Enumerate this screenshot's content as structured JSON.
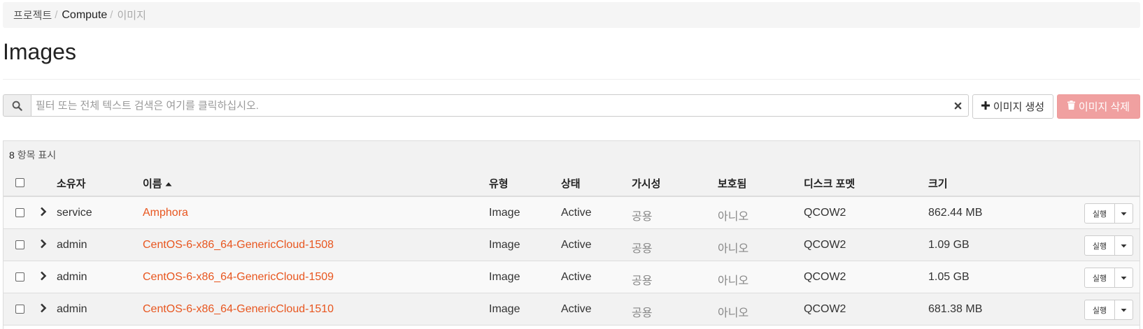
{
  "breadcrumb": {
    "items": [
      "프로젝트",
      "Compute",
      "이미지"
    ]
  },
  "page": {
    "title": "Images"
  },
  "search": {
    "placeholder": "필터 또는 전체 텍스트 검색은 여기를 클릭하십시오.",
    "icon": "search-icon",
    "clear_icon": "close-icon"
  },
  "actions": {
    "create_label": "이미지 생성",
    "delete_label": "이미지 삭제",
    "create_icon": "plus-icon",
    "delete_icon": "trash-icon"
  },
  "table": {
    "count_number": "8",
    "count_text": "항목 표시",
    "headers": {
      "owner": "소유자",
      "name": "이름",
      "type": "유형",
      "status": "상태",
      "visibility": "가시성",
      "protected": "보호됨",
      "disk_format": "디스크 포멧",
      "size": "크기"
    },
    "sort": {
      "column": "name",
      "direction": "asc"
    },
    "rows": [
      {
        "owner": "service",
        "name": "Amphora",
        "type": "Image",
        "status": "Active",
        "visibility": "공용",
        "protected": "아니오",
        "disk_format": "QCOW2",
        "size": "862.44 MB",
        "action": "실행"
      },
      {
        "owner": "admin",
        "name": "CentOS-6-x86_64-GenericCloud-1508",
        "type": "Image",
        "status": "Active",
        "visibility": "공용",
        "protected": "아니오",
        "disk_format": "QCOW2",
        "size": "1.09 GB",
        "action": "실행"
      },
      {
        "owner": "admin",
        "name": "CentOS-6-x86_64-GenericCloud-1509",
        "type": "Image",
        "status": "Active",
        "visibility": "공용",
        "protected": "아니오",
        "disk_format": "QCOW2",
        "size": "1.05 GB",
        "action": "실행"
      },
      {
        "owner": "admin",
        "name": "CentOS-6-x86_64-GenericCloud-1510",
        "type": "Image",
        "status": "Active",
        "visibility": "공용",
        "protected": "아니오",
        "disk_format": "QCOW2",
        "size": "681.38 MB",
        "action": "실행"
      }
    ]
  },
  "colors": {
    "link": "#e8561f",
    "danger_button": "#f0a0a0",
    "header_bg": "#f2f2f2"
  }
}
